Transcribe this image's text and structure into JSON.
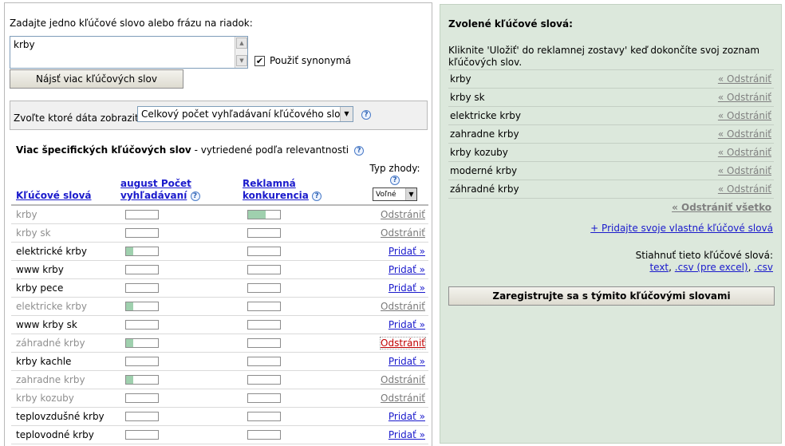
{
  "input_section": {
    "prompt": "Zadajte jedno kľúčové slovo alebo frázu na riadok:",
    "keyword_value": "krby",
    "synonyms_label": "Použiť synonymá",
    "synonyms_checked": true,
    "find_button": "Nájsť viac kľúčových slov"
  },
  "data_selector": {
    "label": "Zvoľte ktoré dáta zobraziť:",
    "selected": "Celkový počet vyhľadávaní kľúčového slova"
  },
  "results": {
    "title": "Viac špecifických kľúčových slov",
    "subtitle": " - vytriedené podľa relevantnosti",
    "columns": {
      "keywords": "Kľúčové slová",
      "searches_line1": "august Počet",
      "searches_line2": "vyhľadávaní",
      "competition_line1": "Reklamná",
      "competition_line2": "konkurencia",
      "match_type": "Typ zhody:",
      "match_value": "Voľné"
    },
    "rows": [
      {
        "keyword": "krby",
        "search_level": 0.0,
        "comp_level": 0.55,
        "action": "Odstrániť",
        "state": "selected"
      },
      {
        "keyword": "krby sk",
        "search_level": 0.0,
        "comp_level": 0.0,
        "action": "Odstrániť",
        "state": "selected"
      },
      {
        "keyword": "elektrické krby",
        "search_level": 0.22,
        "comp_level": 0.0,
        "action": "Pridať »",
        "state": "normal"
      },
      {
        "keyword": "www krby",
        "search_level": 0.0,
        "comp_level": 0.0,
        "action": "Pridať »",
        "state": "normal"
      },
      {
        "keyword": "krby pece",
        "search_level": 0.0,
        "comp_level": 0.0,
        "action": "Pridať »",
        "state": "normal"
      },
      {
        "keyword": "elektricke krby",
        "search_level": 0.22,
        "comp_level": 0.0,
        "action": "Odstrániť",
        "state": "selected"
      },
      {
        "keyword": "www krby sk",
        "search_level": 0.0,
        "comp_level": 0.0,
        "action": "Pridať »",
        "state": "normal"
      },
      {
        "keyword": "záhradné krby",
        "search_level": 0.22,
        "comp_level": 0.0,
        "action": "Odstrániť",
        "state": "highlight"
      },
      {
        "keyword": "krby kachle",
        "search_level": 0.0,
        "comp_level": 0.0,
        "action": "Pridať »",
        "state": "normal"
      },
      {
        "keyword": "zahradne krby",
        "search_level": 0.22,
        "comp_level": 0.0,
        "action": "Odstrániť",
        "state": "selected"
      },
      {
        "keyword": "krby kozuby",
        "search_level": 0.0,
        "comp_level": 0.0,
        "action": "Odstrániť",
        "state": "selected"
      },
      {
        "keyword": "teplovzdušné krby",
        "search_level": 0.0,
        "comp_level": 0.0,
        "action": "Pridať »",
        "state": "normal"
      },
      {
        "keyword": "teplovodné krby",
        "search_level": 0.0,
        "comp_level": 0.0,
        "action": "Pridať »",
        "state": "normal"
      }
    ]
  },
  "selected_panel": {
    "title": "Zvolené kľúčové slová:",
    "instructions": "Kliknite 'Uložiť' do reklamnej zostavy' keď dokončíte svoj zoznam kľúčových slov.",
    "remove_label": "« Odstrániť",
    "items": [
      "krby",
      "krby sk",
      "elektricke krby",
      "zahradne krby",
      "krby kozuby",
      "moderné krby",
      "záhradné krby"
    ],
    "remove_all": "« Odstrániť všetko",
    "add_own": "+ Pridajte svoje vlastné kľúčové slová",
    "download_label": "Stiahnuť tieto kľúčové slová:",
    "download_text": "text",
    "download_csv_excel": ".csv (pre excel)",
    "download_csv": ".csv",
    "register_button": "Zaregistrujte sa s týmito kľúčovými slovami"
  },
  "colors": {
    "bar_fill": "#9fd0ae",
    "right_panel_bg": "#dce8dc",
    "link": "#1a1acc"
  }
}
